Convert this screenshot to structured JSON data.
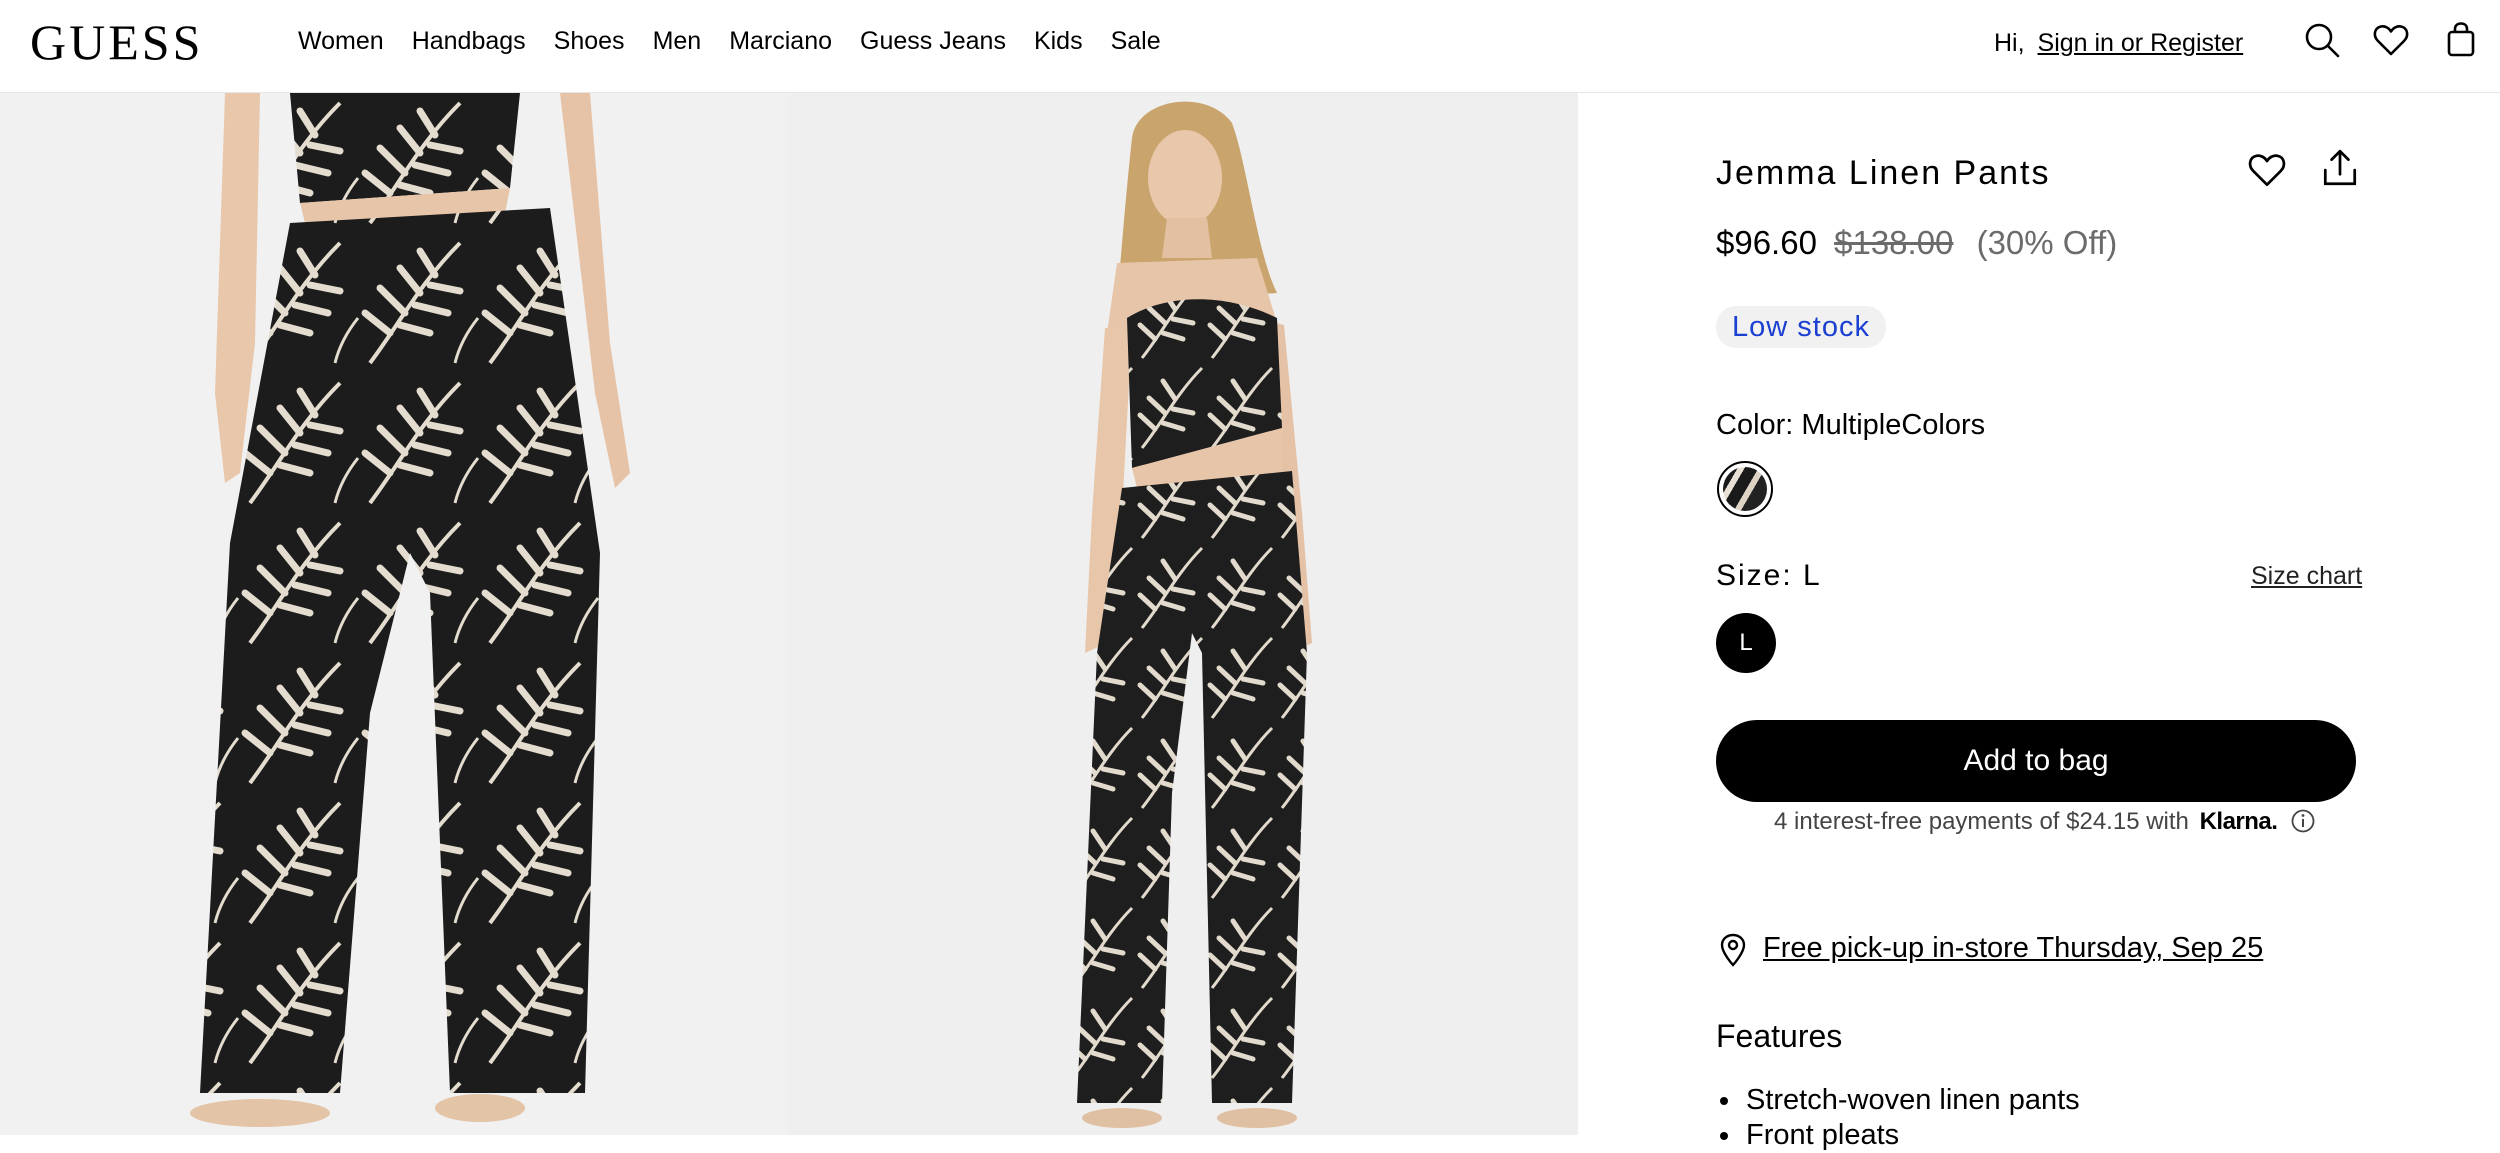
{
  "header": {
    "logo": "GUESS",
    "nav": [
      "Women",
      "Handbags",
      "Shoes",
      "Men",
      "Marciano",
      "Guess Jeans",
      "Kids",
      "Sale"
    ],
    "greeting": "Hi,",
    "account_link": "Sign in or Register",
    "icons": [
      "search-icon",
      "heart-icon",
      "bag-icon"
    ]
  },
  "product": {
    "title": "Jemma Linen Pants",
    "price_now": "$96.60",
    "price_was": "$138.00",
    "discount": "(30% Off)",
    "stock_badge": "Low stock",
    "color_label": "Color: MultipleColors",
    "size_label": "Size: L",
    "size_chart": "Size chart",
    "sizes": [
      "L"
    ],
    "add_to_bag": "Add to bag",
    "klarna_text": "4 interest-free payments of $24.15 with",
    "klarna_brand": "Klarna.",
    "pickup": "Free pick-up in-store Thursday, Sep 25",
    "features_title": "Features",
    "features": [
      "Stretch-woven linen pants",
      "Front pleats"
    ]
  },
  "colors": {
    "badge_text": "#1a3fd1",
    "button": "#000000",
    "strike": "#6b6b6b"
  }
}
